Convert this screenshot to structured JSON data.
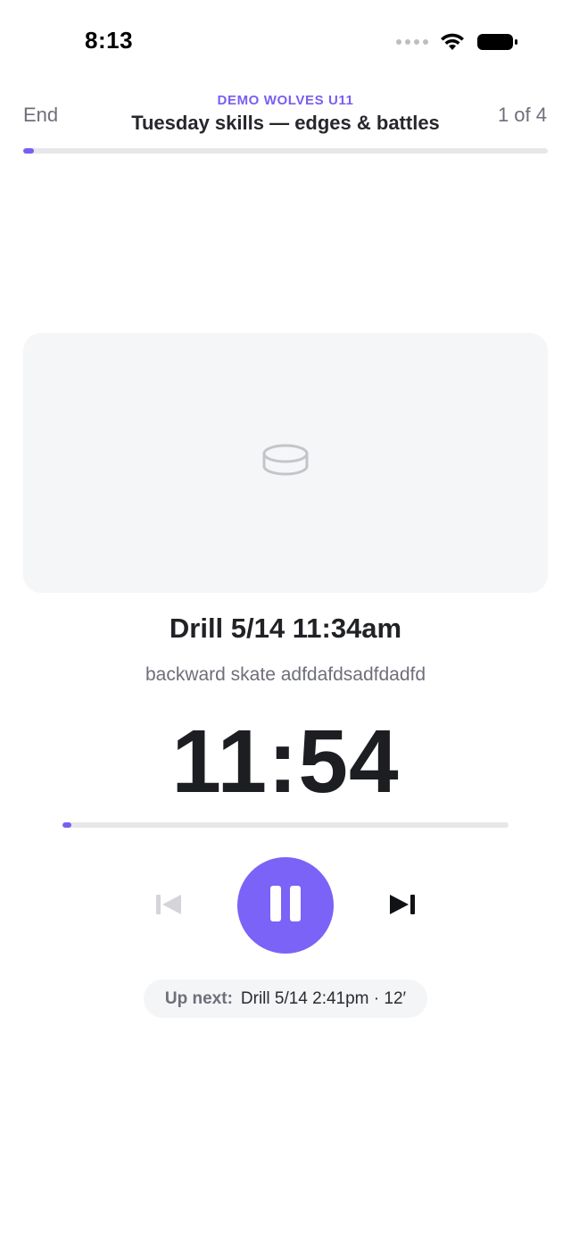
{
  "status_bar": {
    "time": "8:13",
    "icons": [
      "cellular-signal-icon",
      "wifi-icon",
      "battery-icon"
    ]
  },
  "header": {
    "end_label": "End",
    "team_name": "DEMO WOLVES U11",
    "session_title": "Tuesday skills — edges & battles",
    "drill_counter": "1 of 4",
    "session_progress_fraction": 0.02
  },
  "media": {
    "placeholder_icon": "hockey-puck-icon"
  },
  "drill": {
    "title": "Drill 5/14 11:34am",
    "description": "backward skate adfdafdsadfdadfd",
    "time_remaining": "11:54",
    "progress_fraction": 0.02
  },
  "controls": {
    "previous_icon": "skip-previous-icon",
    "pause_icon": "pause-icon",
    "next_icon": "skip-next-icon",
    "previous_enabled": false
  },
  "up_next": {
    "label": "Up next:",
    "value": "Drill 5/14 2:41pm · 12′"
  },
  "colors": {
    "accent": "#7a63f6",
    "text_primary": "#1d1e22",
    "text_secondary": "#6d6f7a",
    "card_background": "#f5f6f8"
  }
}
